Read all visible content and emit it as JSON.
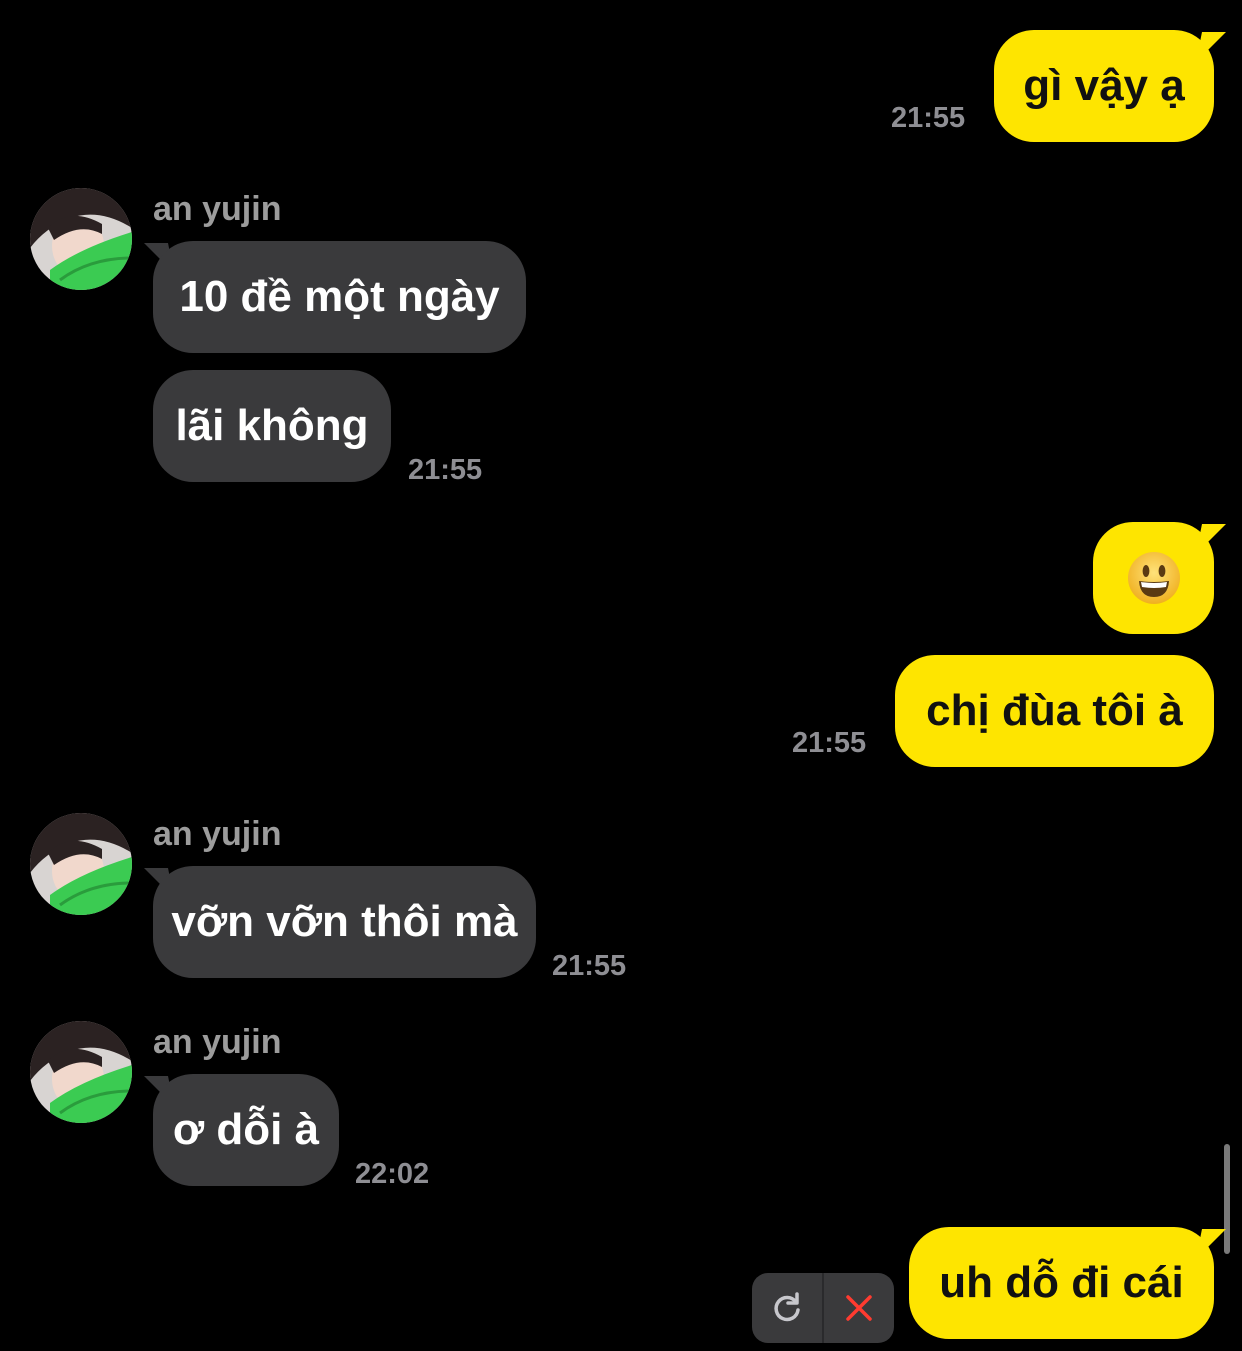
{
  "colors": {
    "background": "#000000",
    "outgoing_bubble": "#fee500",
    "incoming_bubble": "#3a3a3c",
    "timestamp": "#8e8e93",
    "sender_name": "#9c9c9c",
    "retry_icon": "#c7c7cc",
    "delete_icon": "#ff3b30"
  },
  "messages": [
    {
      "direction": "outgoing",
      "text": "gì vậy ạ",
      "time": "21:55"
    },
    {
      "direction": "incoming",
      "sender": "an yujin",
      "text": "10 đề một ngày"
    },
    {
      "direction": "incoming",
      "text": "lãi không",
      "time": "21:55"
    },
    {
      "direction": "outgoing",
      "emoji": "smiling-face-emoji"
    },
    {
      "direction": "outgoing",
      "text": "chị đùa tôi à",
      "time": "21:55"
    },
    {
      "direction": "incoming",
      "sender": "an yujin",
      "text": "vỡn vỡn thôi mà",
      "time": "21:55"
    },
    {
      "direction": "incoming",
      "sender": "an yujin",
      "text": "ơ dỗi à",
      "time": "22:02"
    },
    {
      "direction": "outgoing",
      "text": "uh dỗ đi cái",
      "status": "failed"
    }
  ],
  "failed_actions": {
    "retry_icon": "retry-icon",
    "delete_icon": "close-icon"
  }
}
